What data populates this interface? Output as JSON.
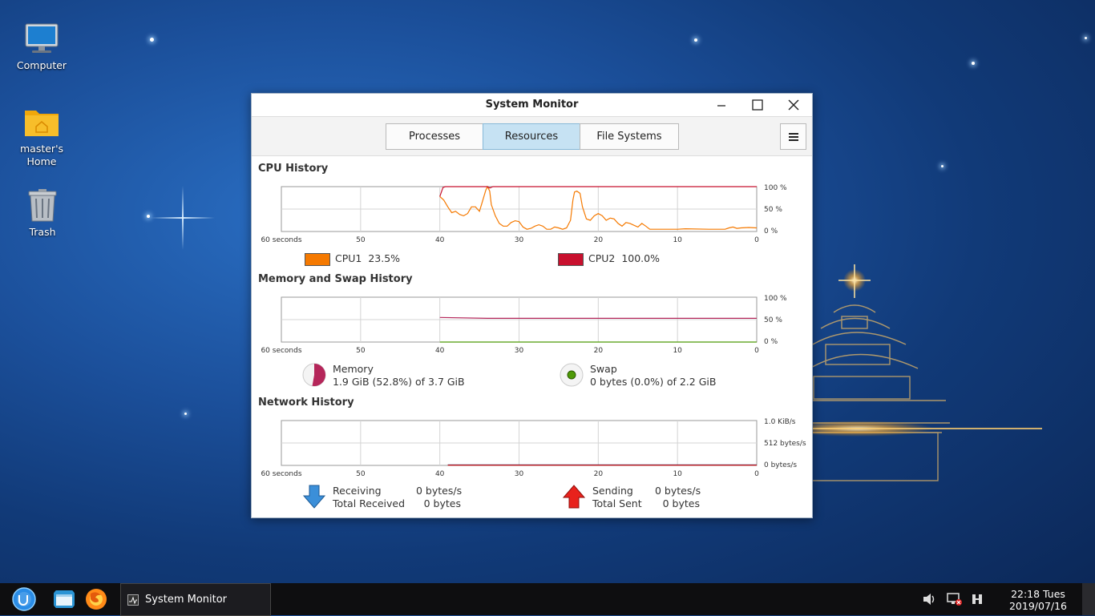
{
  "desktop": {
    "icons": [
      {
        "label": "Computer"
      },
      {
        "label": "master's Home"
      },
      {
        "label": "Trash"
      }
    ]
  },
  "window": {
    "title": "System Monitor",
    "tabs": [
      "Processes",
      "Resources",
      "File Systems"
    ],
    "active_tab": "Resources"
  },
  "cpu": {
    "section_title": "CPU History",
    "y_ticks": [
      "100 %",
      "50 %",
      "0 %"
    ],
    "x_ticks": [
      "60 seconds",
      "50",
      "40",
      "30",
      "20",
      "10",
      "0"
    ],
    "cpu1": {
      "label": "CPU1",
      "value": "23.5%",
      "color": "#f57900"
    },
    "cpu2": {
      "label": "CPU2",
      "value": "100.0%",
      "color": "#c8102e"
    },
    "cpu1_series": [
      {
        "t": 40,
        "v": 78
      },
      {
        "t": 39.5,
        "v": 70
      },
      {
        "t": 39,
        "v": 55
      },
      {
        "t": 38.5,
        "v": 42
      },
      {
        "t": 38,
        "v": 45
      },
      {
        "t": 37.5,
        "v": 38
      },
      {
        "t": 37,
        "v": 35
      },
      {
        "t": 36.5,
        "v": 40
      },
      {
        "t": 36,
        "v": 55
      },
      {
        "t": 35.5,
        "v": 55
      },
      {
        "t": 35,
        "v": 45
      },
      {
        "t": 34.7,
        "v": 62
      },
      {
        "t": 34.2,
        "v": 92
      },
      {
        "t": 34,
        "v": 100
      },
      {
        "t": 33.7,
        "v": 90
      },
      {
        "t": 33.5,
        "v": 60
      },
      {
        "t": 33,
        "v": 35
      },
      {
        "t": 32.5,
        "v": 18
      },
      {
        "t": 32,
        "v": 12
      },
      {
        "t": 31.5,
        "v": 12
      },
      {
        "t": 31,
        "v": 20
      },
      {
        "t": 30.5,
        "v": 24
      },
      {
        "t": 30,
        "v": 22
      },
      {
        "t": 29.5,
        "v": 10
      },
      {
        "t": 29,
        "v": 5
      },
      {
        "t": 28.5,
        "v": 7
      },
      {
        "t": 28,
        "v": 12
      },
      {
        "t": 27.5,
        "v": 15
      },
      {
        "t": 27,
        "v": 12
      },
      {
        "t": 26.5,
        "v": 5
      },
      {
        "t": 26,
        "v": 5
      },
      {
        "t": 25.5,
        "v": 10
      },
      {
        "t": 25,
        "v": 8
      },
      {
        "t": 24.5,
        "v": 5
      },
      {
        "t": 24,
        "v": 8
      },
      {
        "t": 23.5,
        "v": 25
      },
      {
        "t": 23.2,
        "v": 70
      },
      {
        "t": 23,
        "v": 88
      },
      {
        "t": 22.7,
        "v": 90
      },
      {
        "t": 22.3,
        "v": 85
      },
      {
        "t": 22,
        "v": 55
      },
      {
        "t": 21.5,
        "v": 28
      },
      {
        "t": 21,
        "v": 25
      },
      {
        "t": 20.5,
        "v": 35
      },
      {
        "t": 20,
        "v": 40
      },
      {
        "t": 19.5,
        "v": 35
      },
      {
        "t": 19,
        "v": 25
      },
      {
        "t": 18.5,
        "v": 30
      },
      {
        "t": 18,
        "v": 28
      },
      {
        "t": 17.5,
        "v": 18
      },
      {
        "t": 17,
        "v": 12
      },
      {
        "t": 16.5,
        "v": 20
      },
      {
        "t": 16,
        "v": 18
      },
      {
        "t": 15.5,
        "v": 14
      },
      {
        "t": 15,
        "v": 10
      },
      {
        "t": 14.5,
        "v": 18
      },
      {
        "t": 14,
        "v": 12
      },
      {
        "t": 13.5,
        "v": 5
      },
      {
        "t": 13,
        "v": 5
      },
      {
        "t": 10,
        "v": 5
      },
      {
        "t": 9,
        "v": 6
      },
      {
        "t": 6,
        "v": 5
      },
      {
        "t": 4,
        "v": 5
      },
      {
        "t": 3.5,
        "v": 8
      },
      {
        "t": 3,
        "v": 10
      },
      {
        "t": 2.5,
        "v": 7
      },
      {
        "t": 2,
        "v": 8
      },
      {
        "t": 1,
        "v": 9
      },
      {
        "t": 0,
        "v": 8
      }
    ],
    "cpu2_series": [
      {
        "t": 40,
        "v": 78
      },
      {
        "t": 39.6,
        "v": 98
      },
      {
        "t": 39.3,
        "v": 100
      },
      {
        "t": 34,
        "v": 100
      },
      {
        "t": 33.7,
        "v": 97
      },
      {
        "t": 33.3,
        "v": 100
      },
      {
        "t": 0,
        "v": 100
      }
    ]
  },
  "memory": {
    "section_title": "Memory and Swap History",
    "y_ticks": [
      "100 %",
      "50 %",
      "0 %"
    ],
    "x_ticks": [
      "60 seconds",
      "50",
      "40",
      "30",
      "20",
      "10",
      "0"
    ],
    "memory_label": "Memory",
    "memory_value": "1.9 GiB (52.8%) of 3.7 GiB",
    "memory_color": "#b5265a",
    "memory_percent": 52.8,
    "swap_label": "Swap",
    "swap_value": "0 bytes (0.0%) of 2.2 GiB",
    "swap_color": "#4e9a06",
    "swap_percent": 0
  },
  "network": {
    "section_title": "Network History",
    "y_ticks": [
      "1.0 KiB/s",
      "512 bytes/s",
      "0 bytes/s"
    ],
    "x_ticks": [
      "60 seconds",
      "50",
      "40",
      "30",
      "20",
      "10",
      "0"
    ],
    "receiving_label": "Receiving",
    "receiving_value": "0 bytes/s",
    "total_received_label": "Total Received",
    "total_received_value": "0 bytes",
    "sending_label": "Sending",
    "sending_value": "0 bytes/s",
    "total_sent_label": "Total Sent",
    "total_sent_value": "0 bytes",
    "receiving_color": "#3465a4",
    "sending_color": "#cc0000"
  },
  "taskbar": {
    "task_label": "System Monitor",
    "clock_time": "22:18 Tues",
    "clock_date": "2019/07/16"
  }
}
